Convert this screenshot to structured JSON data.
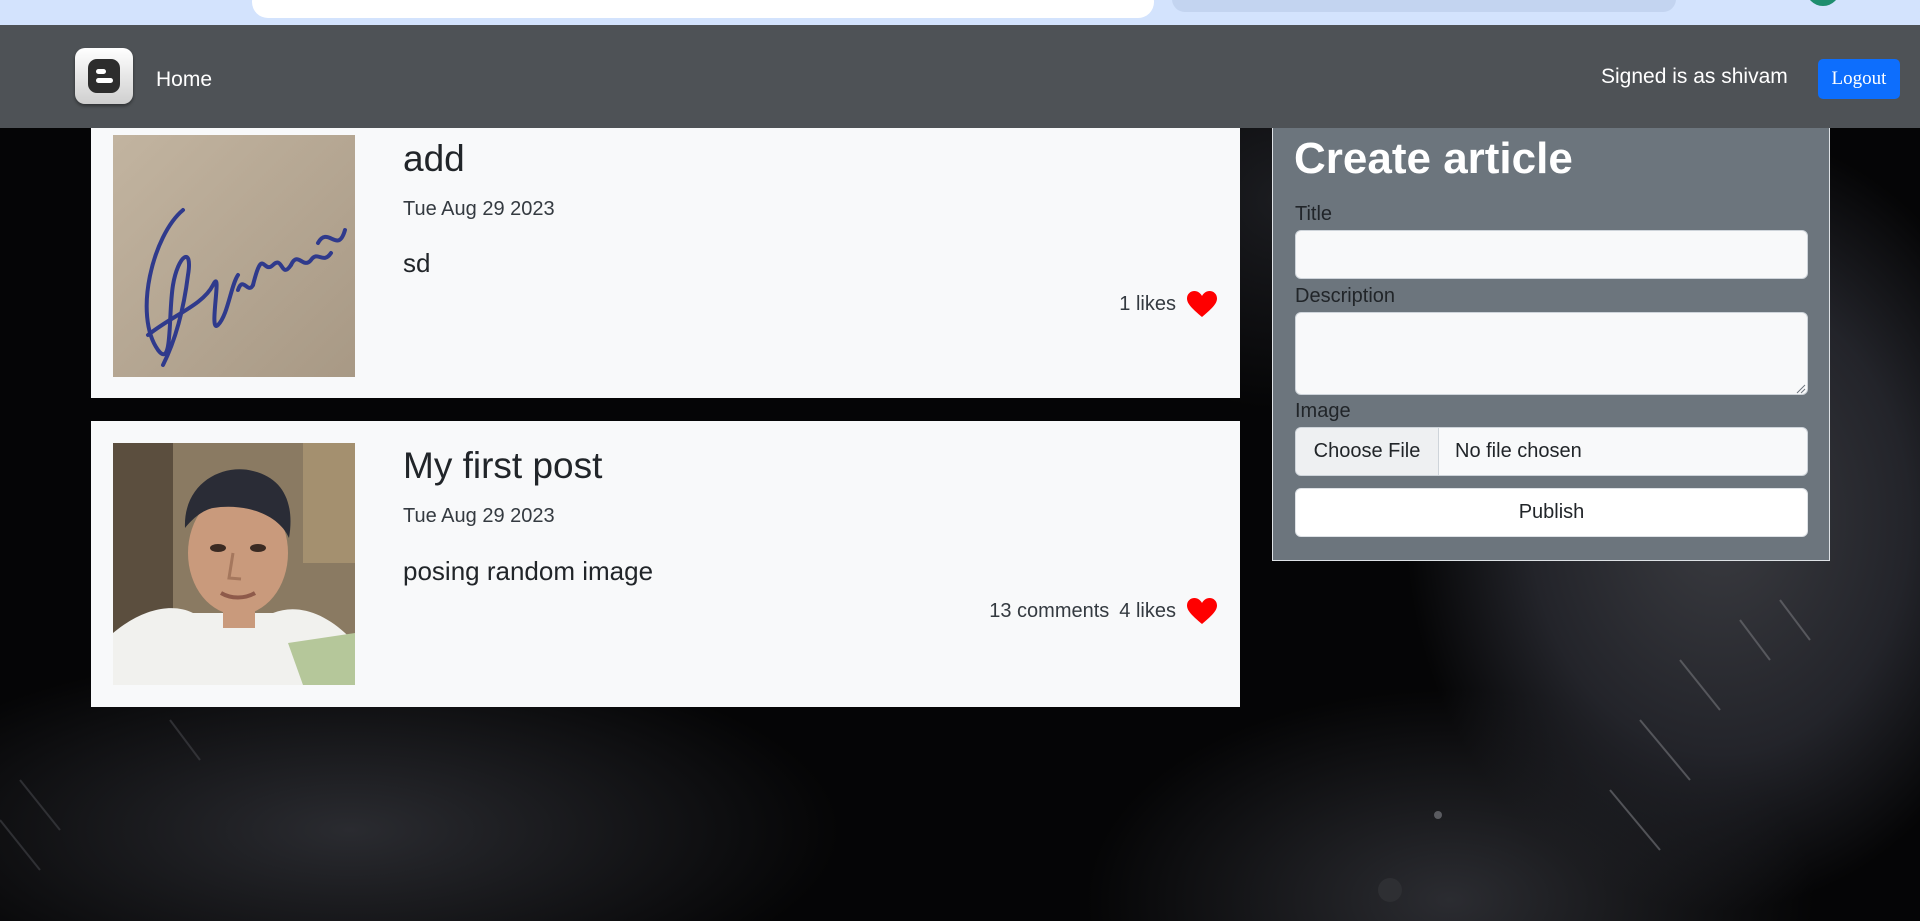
{
  "navbar": {
    "logo_icon": "blogger-logo-icon",
    "home_label": "Home",
    "signed_in_text": "Signed is as shivam",
    "logout_label": "Logout",
    "colors": {
      "bar": "#4e5256",
      "logout": "#0d6efd"
    }
  },
  "posts": [
    {
      "title": "add",
      "date": "Tue Aug 29 2023",
      "description": "sd",
      "comments": "",
      "likes": "1 likes",
      "image_icon": "signature-image"
    },
    {
      "title": "My first post",
      "date": "Tue Aug 29 2023",
      "description": "posing random image",
      "comments": "13 comments",
      "likes": "4 likes",
      "image_icon": "portrait-photo-image"
    }
  ],
  "create_article": {
    "heading": "Create article",
    "title_label": "Title",
    "title_value": "",
    "description_label": "Description",
    "description_value": "",
    "image_label": "Image",
    "choose_file_label": "Choose File",
    "file_status": "No file chosen",
    "publish_label": "Publish"
  },
  "colors": {
    "heart": "#ff0000",
    "panel": "#6c757d",
    "card": "#f8f9fa"
  }
}
